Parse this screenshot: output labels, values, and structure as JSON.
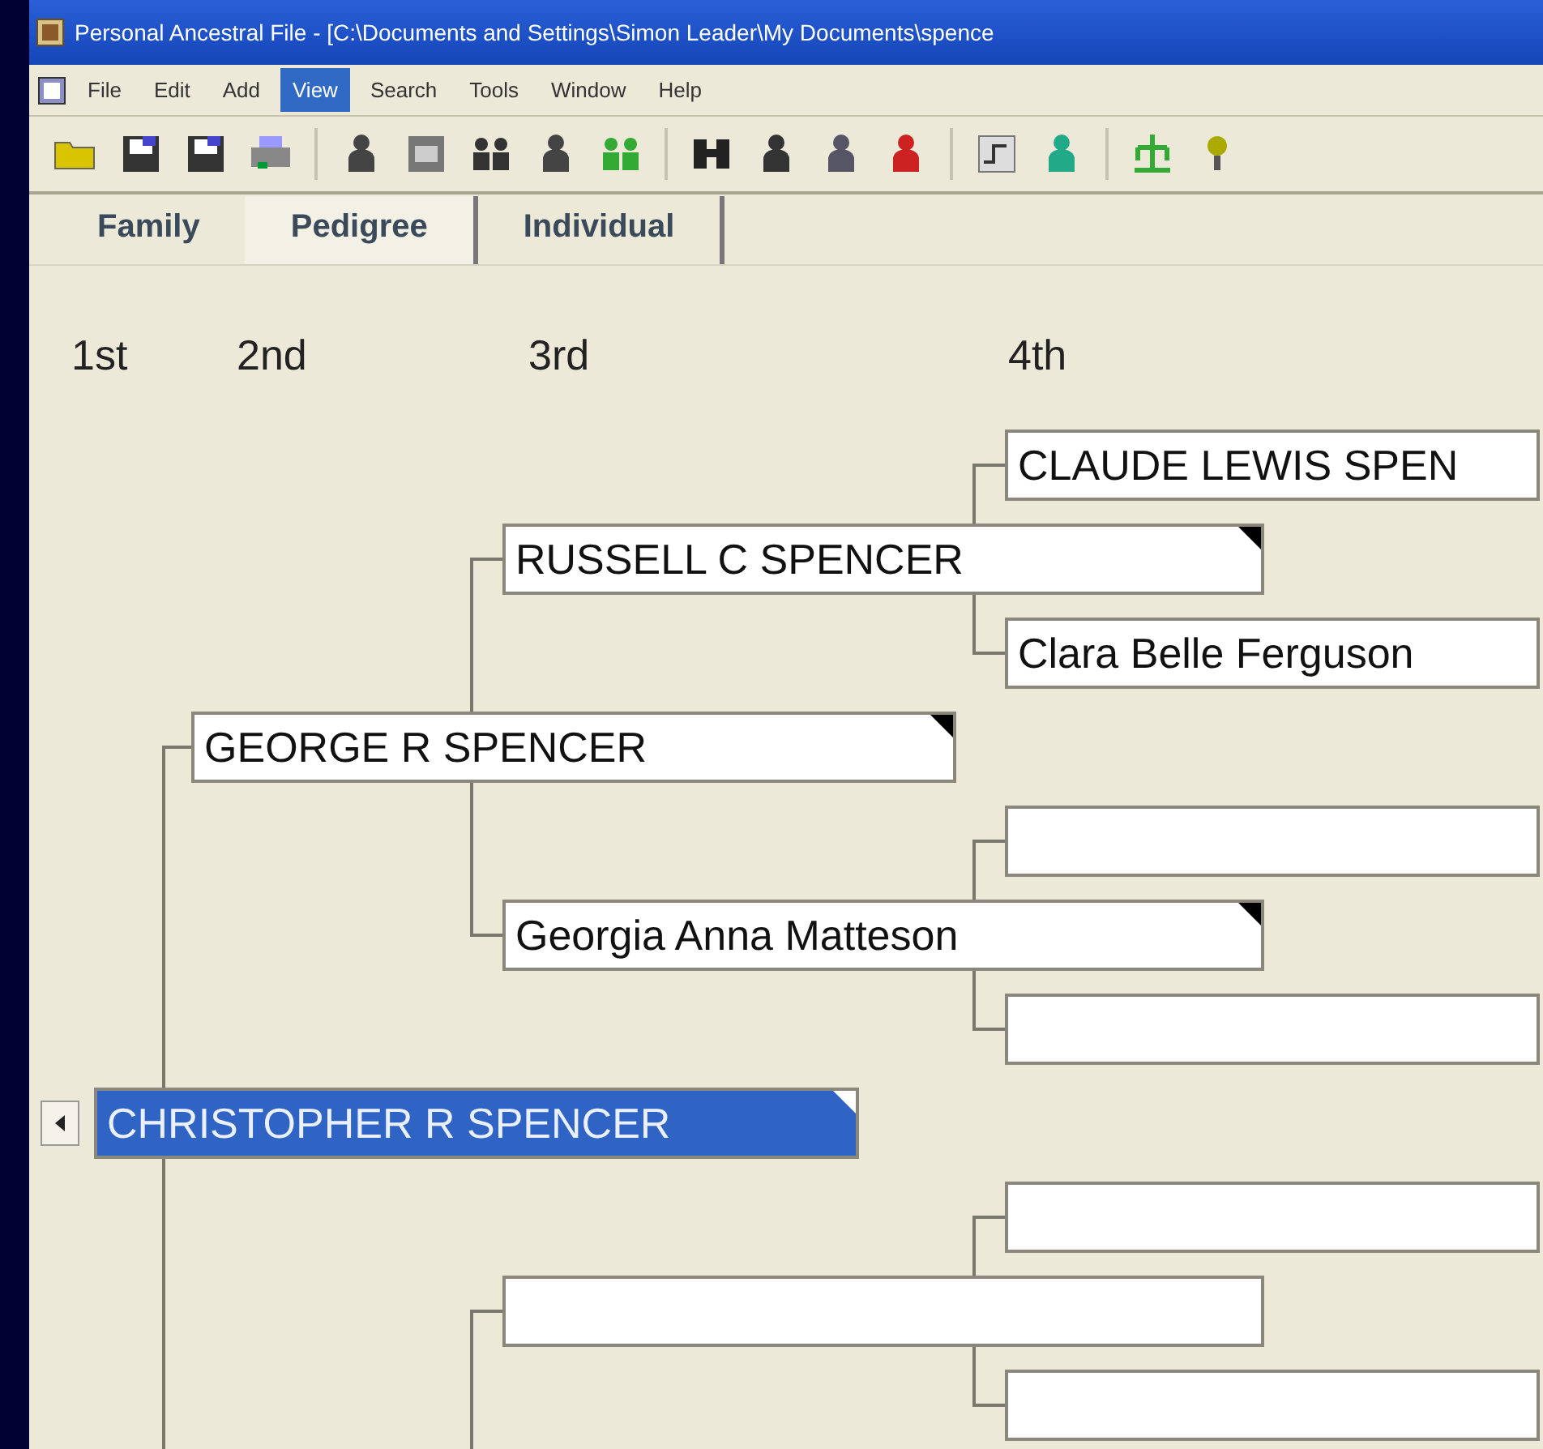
{
  "window": {
    "title": "Personal Ancestral File - [C:\\Documents and Settings\\Simon Leader\\My Documents\\spence"
  },
  "menu": [
    {
      "label": "File",
      "selected": false
    },
    {
      "label": "Edit",
      "selected": false
    },
    {
      "label": "Add",
      "selected": false
    },
    {
      "label": "View",
      "selected": true
    },
    {
      "label": "Search",
      "selected": false
    },
    {
      "label": "Tools",
      "selected": false
    },
    {
      "label": "Window",
      "selected": false
    },
    {
      "label": "Help",
      "selected": false
    }
  ],
  "tabs": [
    {
      "label": "Family",
      "selected": false
    },
    {
      "label": "Pedigree",
      "selected": true
    },
    {
      "label": "Individual",
      "selected": false
    }
  ],
  "generation_headers": [
    "1st",
    "2nd",
    "3rd",
    "4th"
  ],
  "pedigree": {
    "kind": "person",
    "name": "CHRISTOPHER R SPENCER",
    "selected": true,
    "flagged": true,
    "children": [
      {
        "kind": "person",
        "name": "GEORGE R SPENCER",
        "selected": false,
        "flagged": true,
        "children": [
          {
            "kind": "person",
            "name": "RUSSELL C SPENCER",
            "selected": false,
            "flagged": true,
            "children": [
              {
                "kind": "person",
                "name": "CLAUDE LEWIS SPEN",
                "selected": false,
                "flagged": false
              },
              {
                "kind": "person",
                "name": "Clara Belle Ferguson",
                "selected": false,
                "flagged": false
              }
            ]
          },
          {
            "kind": "person",
            "name": "Georgia Anna Matteson",
            "selected": false,
            "flagged": true,
            "children": [
              {
                "kind": "blank"
              },
              {
                "kind": "blank"
              }
            ]
          }
        ]
      },
      {
        "kind": "hidden",
        "children": [
          {
            "kind": "blank",
            "children": [
              {
                "kind": "blank"
              },
              {
                "kind": "blank"
              }
            ]
          }
        ]
      }
    ]
  }
}
